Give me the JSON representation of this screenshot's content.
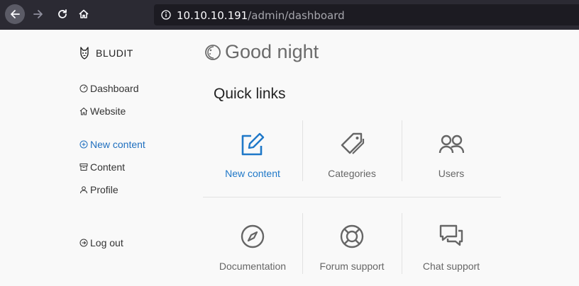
{
  "browser": {
    "url_host": "10.10.10.191",
    "url_path": "/admin/dashboard"
  },
  "sidebar": {
    "brand": "BLUDIT",
    "items": [
      {
        "label": "Dashboard",
        "icon": "dashboard-icon"
      },
      {
        "label": "Website",
        "icon": "home-icon"
      },
      {
        "label": "New content",
        "icon": "plus-circle-icon"
      },
      {
        "label": "Content",
        "icon": "archive-icon"
      },
      {
        "label": "Profile",
        "icon": "person-icon"
      },
      {
        "label": "Log out",
        "icon": "logout-icon"
      }
    ]
  },
  "main": {
    "greeting": "Good night",
    "quick_links_title": "Quick links",
    "tiles": [
      {
        "label": "New content",
        "icon": "edit-icon",
        "accent": "#1f78c8"
      },
      {
        "label": "Categories",
        "icon": "tags-icon"
      },
      {
        "label": "Users",
        "icon": "users-icon"
      },
      {
        "label": "Documentation",
        "icon": "compass-icon"
      },
      {
        "label": "Forum support",
        "icon": "lifebuoy-icon"
      },
      {
        "label": "Chat support",
        "icon": "chat-icon"
      }
    ]
  }
}
